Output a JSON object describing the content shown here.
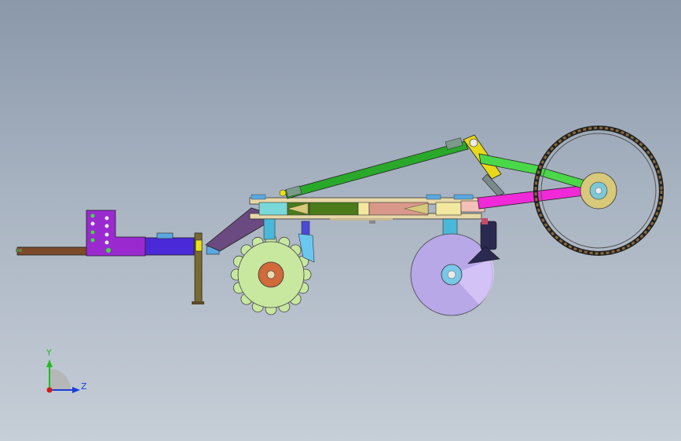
{
  "axes": {
    "y_label": "Y",
    "z_label": "Z",
    "y_color": "#22bb22",
    "z_color": "#1a3fd8",
    "x_color": "#d11a1a"
  },
  "palette": {
    "hitch_bar": "#7a4a2a",
    "hitch_plate": "#9a2ad0",
    "beam_front": "#4a2ad8",
    "support_post": "#7a6a30",
    "mount_arm": "#6a4a80",
    "cutting_wheel": "#c8e8a0",
    "wheel_hub": "#d06a3a",
    "main_frame": "#e8d8a8",
    "frame_green": "#4a7a1a",
    "frame_pink": "#d8988a",
    "cyan_block": "#7ad8d8",
    "top_link": "#2aa82a",
    "link_yellow": "#e8d81a",
    "press_arm_green": "#4ad84a",
    "press_arm_magenta": "#f02ad8",
    "press_wheel_hub": "#d8c87a",
    "disc_opener": "#b8a8e8",
    "furrow_opener": "#2a2a50"
  }
}
